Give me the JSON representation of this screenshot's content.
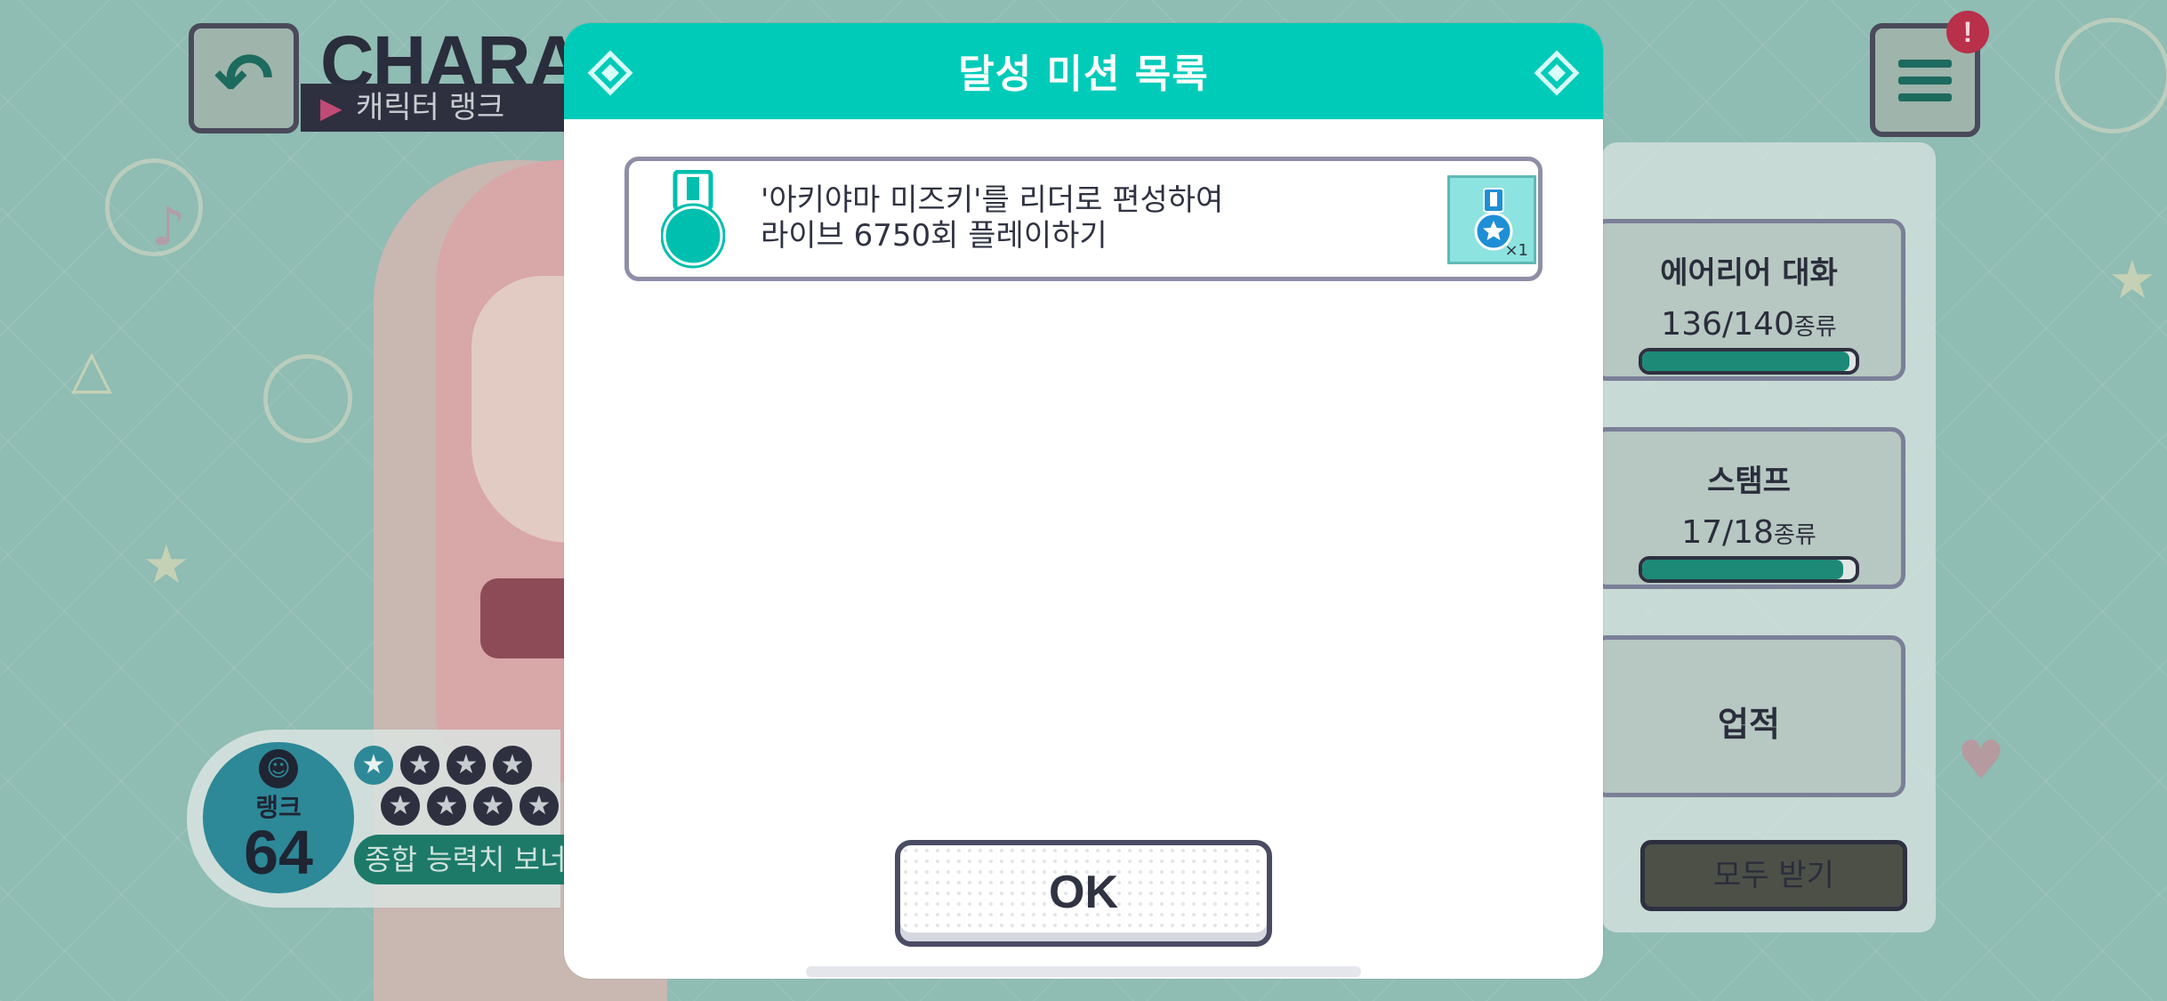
{
  "background": {
    "header": {
      "title": "CHARAC",
      "subtitle": "캐릭터 랭크"
    },
    "stats": [
      {
        "label": "에어리어 대화",
        "count": "136/140",
        "unit": "종류",
        "progress": 0.97
      },
      {
        "label": "스탬프",
        "count": "17/18",
        "unit": "종류",
        "progress": 0.94
      }
    ],
    "achievements_label": "업적",
    "receive_all_label": "모두 받기",
    "rank": {
      "label": "랭크",
      "value": "64",
      "bonus_label": "종합 능력치 보너"
    }
  },
  "modal": {
    "title": "달성 미션 목록",
    "missions": [
      {
        "line1": "'아키야마 미즈키'를 리더로 편성하여",
        "line2": "라이브 6750회 플레이하기",
        "reward_qty": "×1"
      }
    ],
    "ok_label": "OK"
  },
  "colors": {
    "accent": "#00cbb9",
    "modal_bg": "#ffffff",
    "border": "#8e8fa6",
    "text": "#2f3342"
  },
  "icons": {
    "back": "back-arrow-icon",
    "menu": "hamburger-menu-icon",
    "alert": "exclamation-icon",
    "mission": "medal-icon",
    "reward": "star-medal-icon"
  }
}
